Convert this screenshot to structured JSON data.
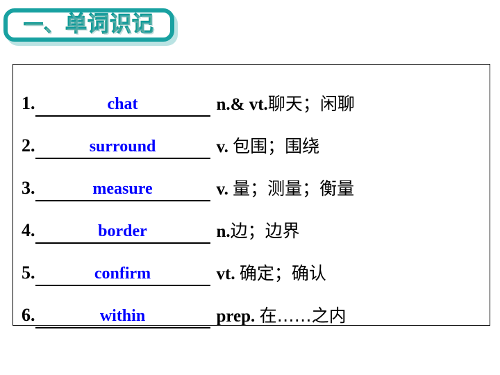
{
  "slide": {
    "title_prefix": "一、",
    "title_text": "单词识记",
    "accent_color": "#18a1a1",
    "word_color": "#0000ff",
    "text_color": "#000000"
  },
  "word_list": {
    "rows": [
      {
        "number": "1.",
        "word": "chat",
        "definition_pos": "n.& vt.",
        "definition_cn": "聊天；闲聊"
      },
      {
        "number": "2.",
        "word": "surround",
        "definition_pos": "v. ",
        "definition_cn": "包围；围绕"
      },
      {
        "number": "3.",
        "word": "measure",
        "definition_pos": "v. ",
        "definition_cn": "量；测量；衡量"
      },
      {
        "number": "4.",
        "word": "border",
        "definition_pos": "n.",
        "definition_cn": "边；边界"
      },
      {
        "number": "5.",
        "word": "confirm",
        "definition_pos": "vt. ",
        "definition_cn": "确定；确认"
      },
      {
        "number": "6.",
        "word": "within",
        "definition_pos": "prep. ",
        "definition_cn": "在……之内"
      }
    ]
  }
}
